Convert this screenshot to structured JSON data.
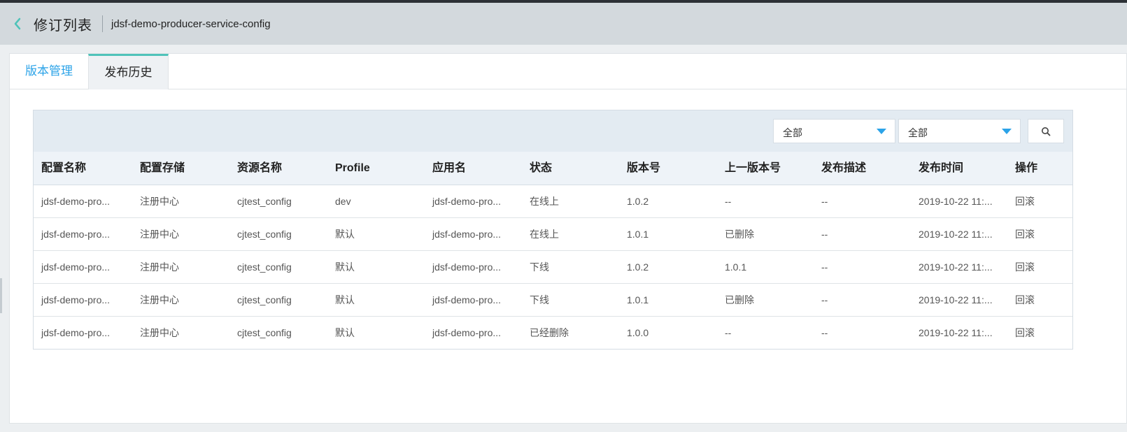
{
  "header": {
    "back_icon": "chevron-left-icon",
    "title": "修订列表",
    "subtitle": "jdsf-demo-producer-service-config"
  },
  "colors": {
    "accent": "#2ba3e8",
    "tab_indicator": "#4fc3b9",
    "back_icon": "#4fc3b9"
  },
  "tabs": [
    {
      "label": "版本管理",
      "active": false
    },
    {
      "label": "发布历史",
      "active": true
    }
  ],
  "filters": {
    "select_1": {
      "value": "全部"
    },
    "select_2": {
      "value": "全部"
    },
    "search_icon": "search-icon"
  },
  "table": {
    "columns": [
      "配置名称",
      "配置存储",
      "资源名称",
      "Profile",
      "应用名",
      "状态",
      "版本号",
      "上一版本号",
      "发布描述",
      "发布时间",
      "操作"
    ],
    "rows": [
      [
        "jdsf-demo-pro...",
        "注册中心",
        "cjtest_config",
        "dev",
        "jdsf-demo-pro...",
        "在线上",
        "1.0.2",
        "--",
        "--",
        "2019-10-22 11:...",
        "回滚"
      ],
      [
        "jdsf-demo-pro...",
        "注册中心",
        "cjtest_config",
        "默认",
        "jdsf-demo-pro...",
        "在线上",
        "1.0.1",
        "已删除",
        "--",
        "2019-10-22 11:...",
        "回滚"
      ],
      [
        "jdsf-demo-pro...",
        "注册中心",
        "cjtest_config",
        "默认",
        "jdsf-demo-pro...",
        "下线",
        "1.0.2",
        "1.0.1",
        "--",
        "2019-10-22 11:...",
        "回滚"
      ],
      [
        "jdsf-demo-pro...",
        "注册中心",
        "cjtest_config",
        "默认",
        "jdsf-demo-pro...",
        "下线",
        "1.0.1",
        "已删除",
        "--",
        "2019-10-22 11:...",
        "回滚"
      ],
      [
        "jdsf-demo-pro...",
        "注册中心",
        "cjtest_config",
        "默认",
        "jdsf-demo-pro...",
        "已经删除",
        "1.0.0",
        "--",
        "--",
        "2019-10-22 11:...",
        "回滚"
      ]
    ]
  }
}
